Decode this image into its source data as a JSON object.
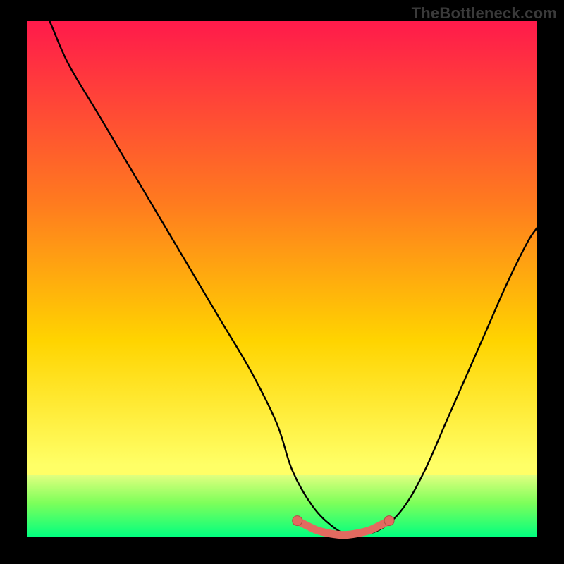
{
  "watermark": "TheBottleneck.com",
  "colors": {
    "gradient_top": "#ff1a4b",
    "gradient_mid1": "#ff7a1f",
    "gradient_mid2": "#ffd400",
    "gradient_low": "#ffff66",
    "green_top": "#dfff7f",
    "green_mid": "#7dff5a",
    "green_bottom": "#00ff80",
    "curve_black": "#000000",
    "marker_fill": "#e26a60",
    "marker_stroke": "#b24d44"
  },
  "chart_data": {
    "type": "line",
    "title": "",
    "xlabel": "",
    "ylabel": "",
    "ylim": [
      0,
      100
    ],
    "xlim": [
      0,
      100
    ],
    "series": [
      {
        "name": "bottleneck-curve",
        "x": [
          0,
          4,
          8,
          14,
          20,
          26,
          32,
          38,
          44,
          49,
          52,
          56,
          60,
          63,
          66,
          70,
          74,
          78,
          82,
          86,
          90,
          94,
          98,
          100
        ],
        "y": [
          108,
          101,
          92,
          82,
          72,
          62,
          52,
          42,
          32,
          22,
          13,
          6,
          2,
          0.5,
          0.5,
          2,
          6,
          13,
          22,
          31,
          40,
          49,
          57,
          60
        ]
      },
      {
        "name": "optimal-marker",
        "x": [
          53,
          55,
          57,
          59,
          61,
          63,
          65,
          67,
          69,
          71
        ],
        "y": [
          3.2,
          2.2,
          1.3,
          0.8,
          0.5,
          0.5,
          0.8,
          1.3,
          2.2,
          3.2
        ]
      }
    ],
    "green_band": {
      "from_percent": 88,
      "to_percent": 100
    }
  }
}
